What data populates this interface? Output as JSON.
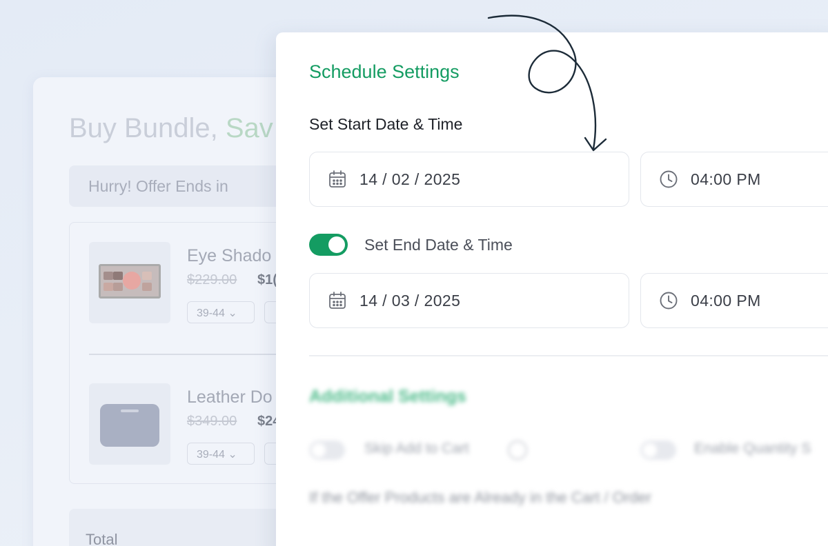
{
  "background_card": {
    "title_part1": "Buy Bundle, ",
    "title_part2": "Sav",
    "hurry_text": "Hurry! Offer Ends in",
    "items": [
      {
        "name": "Eye Shado",
        "old_price": "$229.00",
        "new_price": "$1(",
        "size": "39-44 ⌄"
      },
      {
        "name": "Leather Do",
        "old_price": "$349.00",
        "new_price": "$24",
        "size": "39-44 ⌄"
      }
    ],
    "total_label": "Total"
  },
  "schedule": {
    "title": "Schedule Settings",
    "start_label": "Set Start Date & Time",
    "start_date": "14 / 02 / 2025",
    "start_time": "04:00 PM",
    "end_toggle_on": true,
    "end_label": "Set End Date & Time",
    "end_date": "14 / 03 / 2025",
    "end_time": "04:00 PM"
  },
  "additional": {
    "title": "Additional Settings",
    "option1": "Skip Add to Cart",
    "option2": "Enable Quantity S",
    "note": "If the Offer Products are Already in the Cart / Order"
  },
  "colors": {
    "accent": "#149c62",
    "text": "#1e2128"
  },
  "icons": {
    "date": "calendar-icon",
    "time": "clock-icon",
    "info": "info-icon",
    "decoration": "curved-arrow-icon"
  }
}
